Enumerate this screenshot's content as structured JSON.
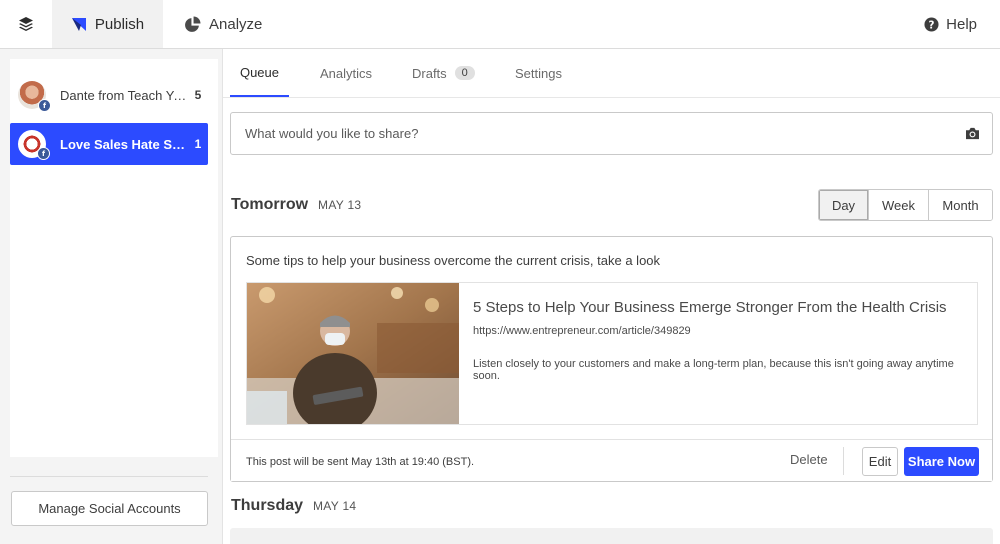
{
  "topbar": {
    "publish_label": "Publish",
    "analyze_label": "Analyze",
    "help_label": "Help"
  },
  "sidebar": {
    "accounts": [
      {
        "name": "Dante from Teach Yo...",
        "count": "5",
        "network": "facebook",
        "selected": false
      },
      {
        "name": "Love Sales Hate Selli...",
        "count": "1",
        "network": "facebook",
        "selected": true
      }
    ],
    "manage_label": "Manage Social Accounts"
  },
  "tabs": [
    {
      "label": "Queue",
      "active": true
    },
    {
      "label": "Analytics",
      "active": false
    },
    {
      "label": "Drafts",
      "badge": "0",
      "active": false
    },
    {
      "label": "Settings",
      "active": false
    }
  ],
  "composer": {
    "placeholder": "What would you like to share?",
    "icon": "camera-icon"
  },
  "days": [
    {
      "day": "Tomorrow",
      "date": "MAY 13"
    },
    {
      "day": "Thursday",
      "date": "MAY 14"
    }
  ],
  "view_toggle": {
    "options": [
      "Day",
      "Week",
      "Month"
    ],
    "selected": "Day"
  },
  "post": {
    "text": "Some tips to help your business overcome the current crisis, take a look",
    "link_title": "5 Steps to Help Your Business Emerge Stronger From the Health Crisis",
    "link_url": "https://www.entrepreneur.com/article/349829",
    "link_description": "Listen closely to your customers and make a long-term plan, because this isn't going away anytime soon.",
    "schedule_text": "This post will be sent May 13th at 19:40 (BST).",
    "delete_label": "Delete",
    "edit_label": "Edit",
    "share_label": "Share Now"
  },
  "colors": {
    "accent": "#2c4bff",
    "facebook": "#3b5998"
  }
}
